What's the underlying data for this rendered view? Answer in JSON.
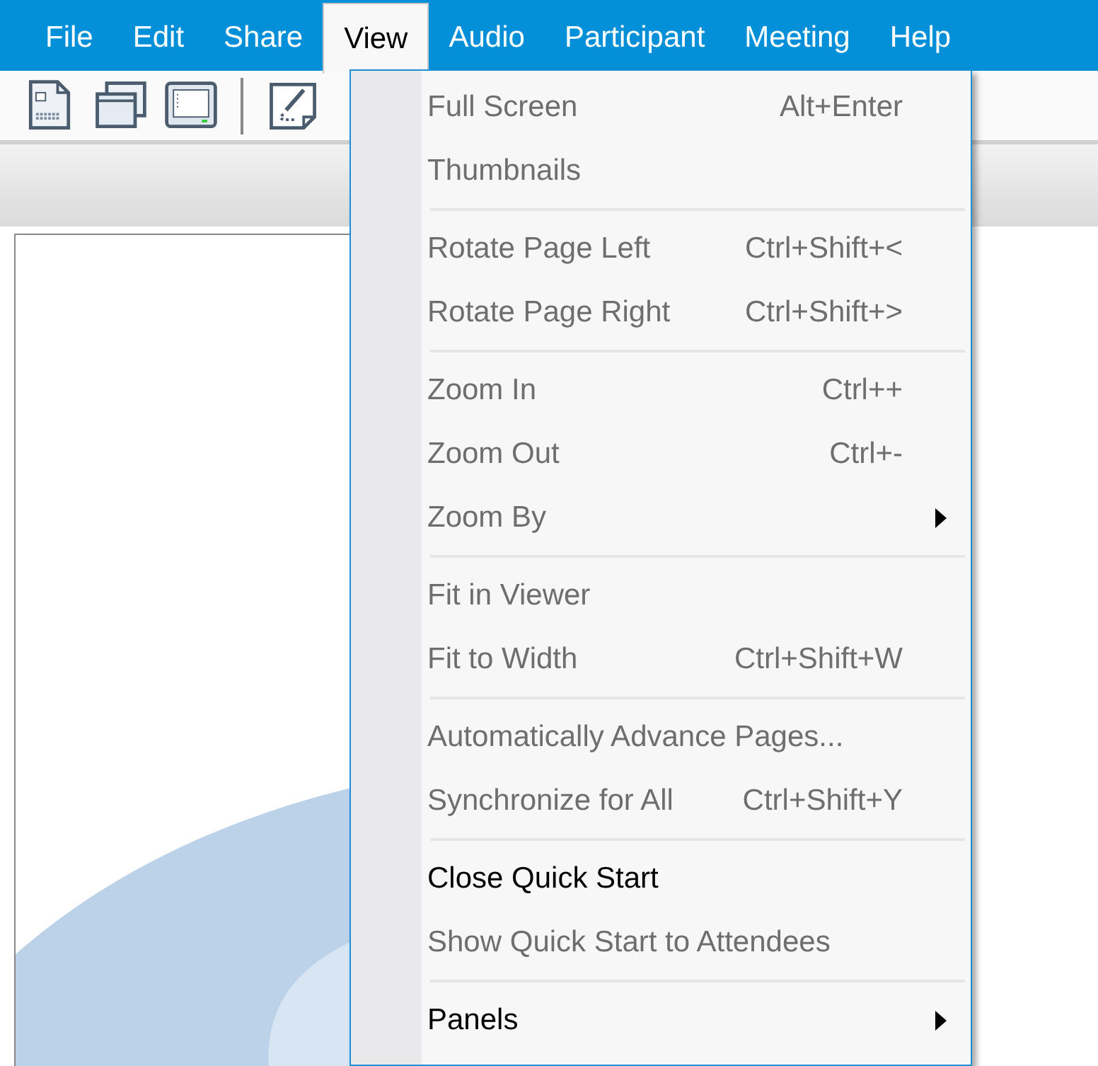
{
  "menu_bar": [
    {
      "label": "File",
      "selected": false
    },
    {
      "label": "Edit",
      "selected": false
    },
    {
      "label": "Share",
      "selected": false
    },
    {
      "label": "View",
      "selected": true
    },
    {
      "label": "Audio",
      "selected": false
    },
    {
      "label": "Participant",
      "selected": false
    },
    {
      "label": "Meeting",
      "selected": false
    },
    {
      "label": "Help",
      "selected": false
    }
  ],
  "toolbar": [
    {
      "kind": "button"
    },
    {
      "kind": "button"
    },
    {
      "kind": "button"
    },
    {
      "kind": "separator"
    },
    {
      "kind": "button"
    }
  ],
  "view_menu": [
    {
      "kind": "item",
      "label": "Full Screen",
      "shortcut": "Alt+Enter",
      "disabled": true
    },
    {
      "kind": "item",
      "label": "Thumbnails",
      "disabled": true
    },
    {
      "kind": "separator"
    },
    {
      "kind": "item",
      "label": "Rotate Page Left",
      "shortcut": "Ctrl+Shift+<",
      "disabled": true
    },
    {
      "kind": "item",
      "label": "Rotate Page Right",
      "shortcut": "Ctrl+Shift+>",
      "disabled": true
    },
    {
      "kind": "separator"
    },
    {
      "kind": "item",
      "label": "Zoom In",
      "shortcut": "Ctrl++",
      "disabled": true
    },
    {
      "kind": "item",
      "label": "Zoom Out",
      "shortcut": "Ctrl+-",
      "disabled": true
    },
    {
      "kind": "submenu",
      "label": "Zoom By",
      "disabled": true
    },
    {
      "kind": "separator"
    },
    {
      "kind": "item",
      "label": "Fit in Viewer",
      "disabled": true
    },
    {
      "kind": "item",
      "label": "Fit to Width",
      "shortcut": "Ctrl+Shift+W",
      "disabled": true
    },
    {
      "kind": "separator"
    },
    {
      "kind": "item",
      "label": "Automatically Advance Pages...",
      "disabled": true
    },
    {
      "kind": "item",
      "label": "Synchronize for All",
      "shortcut": "Ctrl+Shift+Y",
      "disabled": true
    },
    {
      "kind": "separator"
    },
    {
      "kind": "item",
      "label": "Close Quick Start",
      "disabled": false
    },
    {
      "kind": "item",
      "label": "Show Quick Start to Attendees",
      "disabled": true
    },
    {
      "kind": "separator"
    },
    {
      "kind": "submenu",
      "label": "Panels",
      "disabled": false
    }
  ]
}
